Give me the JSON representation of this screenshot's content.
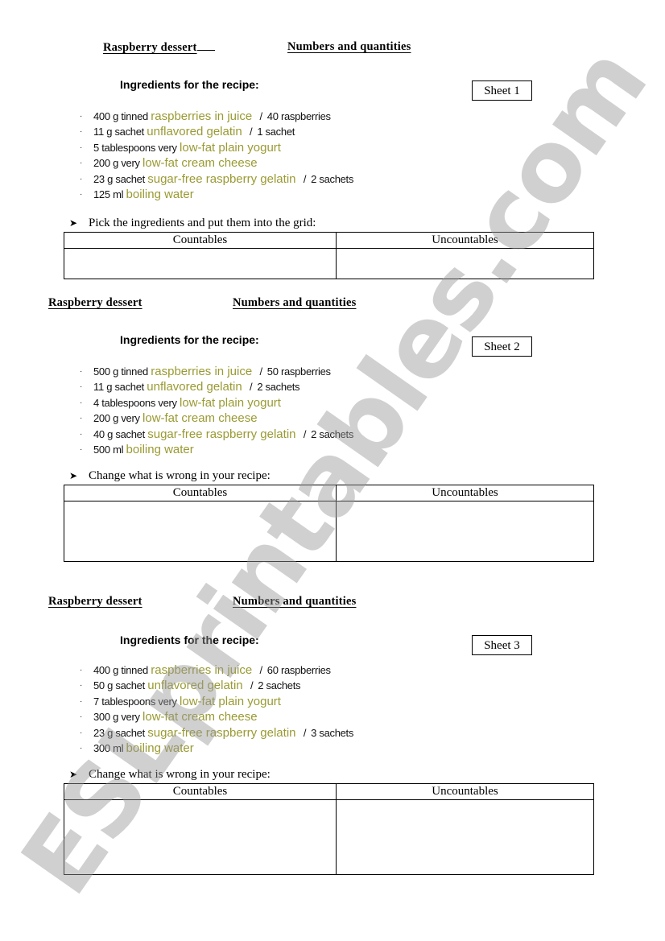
{
  "watermark": "ESLprintables.com",
  "sheets": [
    {
      "title_left": "Raspberry dessert",
      "title_right": "Numbers and quantities",
      "ingredients_heading": "Ingredients  for the recipe:",
      "sheet_label": "Sheet 1",
      "ingredients": [
        {
          "prefix": "400 g tinned",
          "food": "raspberries in juice",
          "suffix": "40 raspberries"
        },
        {
          "prefix": "11 g sachet",
          "food": "unflavored gelatin",
          "suffix": "1 sachet"
        },
        {
          "prefix": "5 tablespoons very",
          "food": "low-fat plain yogurt",
          "suffix": null
        },
        {
          "prefix": "200 g very",
          "food": "low-fat cream cheese",
          "suffix": null
        },
        {
          "prefix": "23 g sachet",
          "food": "sugar-free raspberry gelatin",
          "suffix": "2 sachets"
        },
        {
          "prefix": "125 ml",
          "food": "boiling water",
          "suffix": null
        }
      ],
      "instruction": "Pick the ingredients and put them into the grid:",
      "grid_headers": [
        "Countables",
        "Uncountables"
      ]
    },
    {
      "title_left": "Raspberry dessert",
      "title_right": "Numbers and quantities",
      "ingredients_heading": "Ingredients  for the recipe:",
      "sheet_label": "Sheet 2",
      "ingredients": [
        {
          "prefix": "500 g tinned",
          "food": "raspberries in juice",
          "suffix": "50 raspberries"
        },
        {
          "prefix": "11 g sachet",
          "food": "unflavored gelatin",
          "suffix": "2 sachets"
        },
        {
          "prefix": "4 tablespoons very",
          "food": "low-fat plain yogurt",
          "suffix": null
        },
        {
          "prefix": "200 g very",
          "food": "low-fat cream cheese",
          "suffix": null
        },
        {
          "prefix": "40 g sachet",
          "food": "sugar-free raspberry gelatin",
          "suffix": "2 sachets"
        },
        {
          "prefix": "500 ml",
          "food": "boiling water",
          "suffix": null
        }
      ],
      "instruction": "Change what is wrong in your recipe:",
      "grid_headers": [
        "Countables",
        "Uncountables"
      ]
    },
    {
      "title_left": "Raspberry dessert",
      "title_right": "Numbers and quantities",
      "ingredients_heading": "Ingredients  for the recipe:",
      "sheet_label": "Sheet 3",
      "ingredients": [
        {
          "prefix": "400 g tinned",
          "food": "raspberries in juice",
          "suffix": "60 raspberries"
        },
        {
          "prefix": "50 g sachet",
          "food": "unflavored gelatin",
          "suffix": "2 sachets"
        },
        {
          "prefix": "7 tablespoons very",
          "food": "low-fat plain yogurt",
          "suffix": null
        },
        {
          "prefix": "300 g very",
          "food": "low-fat cream cheese",
          "suffix": null
        },
        {
          "prefix": "23 g sachet",
          "food": "sugar-free raspberry gelatin",
          "suffix": "3 sachets"
        },
        {
          "prefix": "300 ml",
          "food": "boiling water",
          "suffix": null
        }
      ],
      "instruction": "Change what is wrong in your recipe:",
      "grid_headers": [
        "Countables",
        "Uncountables"
      ]
    }
  ],
  "colors": {
    "food_highlight": "#9a9a33",
    "text": "#000000",
    "watermark": "#969696"
  }
}
